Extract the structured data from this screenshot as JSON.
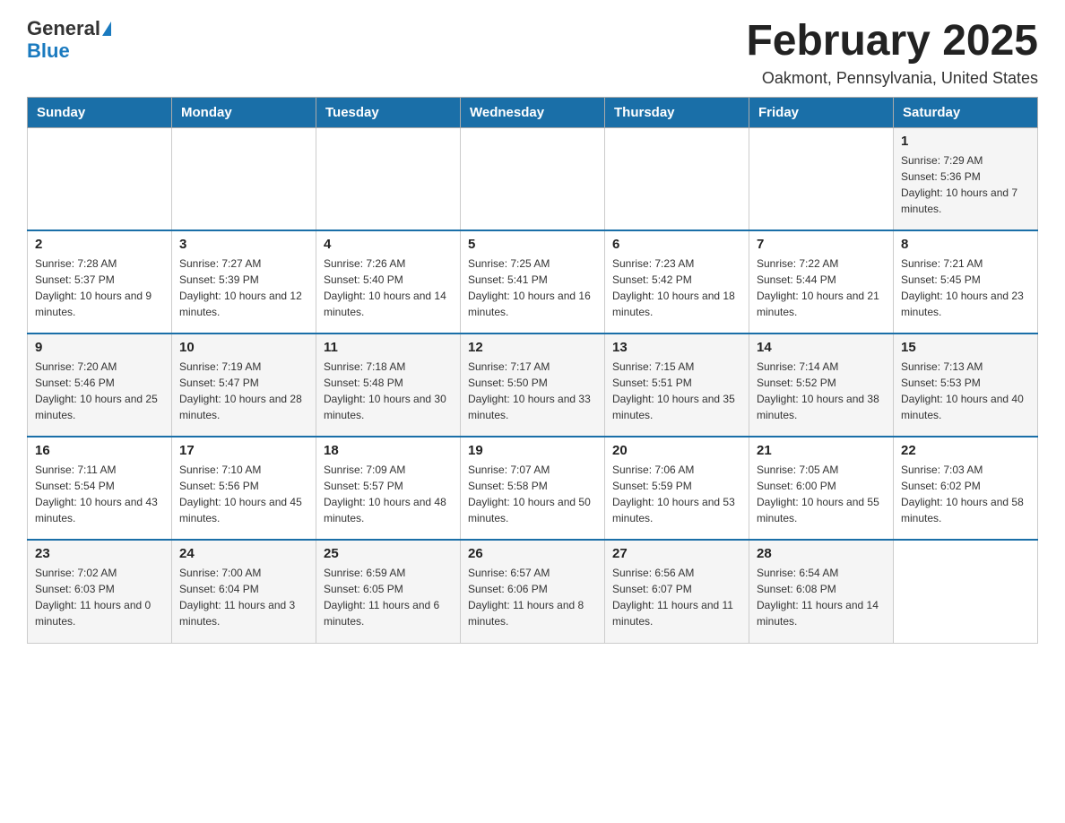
{
  "header": {
    "logo_general": "General",
    "logo_blue": "Blue",
    "month_title": "February 2025",
    "location": "Oakmont, Pennsylvania, United States"
  },
  "days_of_week": [
    "Sunday",
    "Monday",
    "Tuesday",
    "Wednesday",
    "Thursday",
    "Friday",
    "Saturday"
  ],
  "weeks": [
    [
      {
        "day": "",
        "info": ""
      },
      {
        "day": "",
        "info": ""
      },
      {
        "day": "",
        "info": ""
      },
      {
        "day": "",
        "info": ""
      },
      {
        "day": "",
        "info": ""
      },
      {
        "day": "",
        "info": ""
      },
      {
        "day": "1",
        "info": "Sunrise: 7:29 AM\nSunset: 5:36 PM\nDaylight: 10 hours and 7 minutes."
      }
    ],
    [
      {
        "day": "2",
        "info": "Sunrise: 7:28 AM\nSunset: 5:37 PM\nDaylight: 10 hours and 9 minutes."
      },
      {
        "day": "3",
        "info": "Sunrise: 7:27 AM\nSunset: 5:39 PM\nDaylight: 10 hours and 12 minutes."
      },
      {
        "day": "4",
        "info": "Sunrise: 7:26 AM\nSunset: 5:40 PM\nDaylight: 10 hours and 14 minutes."
      },
      {
        "day": "5",
        "info": "Sunrise: 7:25 AM\nSunset: 5:41 PM\nDaylight: 10 hours and 16 minutes."
      },
      {
        "day": "6",
        "info": "Sunrise: 7:23 AM\nSunset: 5:42 PM\nDaylight: 10 hours and 18 minutes."
      },
      {
        "day": "7",
        "info": "Sunrise: 7:22 AM\nSunset: 5:44 PM\nDaylight: 10 hours and 21 minutes."
      },
      {
        "day": "8",
        "info": "Sunrise: 7:21 AM\nSunset: 5:45 PM\nDaylight: 10 hours and 23 minutes."
      }
    ],
    [
      {
        "day": "9",
        "info": "Sunrise: 7:20 AM\nSunset: 5:46 PM\nDaylight: 10 hours and 25 minutes."
      },
      {
        "day": "10",
        "info": "Sunrise: 7:19 AM\nSunset: 5:47 PM\nDaylight: 10 hours and 28 minutes."
      },
      {
        "day": "11",
        "info": "Sunrise: 7:18 AM\nSunset: 5:48 PM\nDaylight: 10 hours and 30 minutes."
      },
      {
        "day": "12",
        "info": "Sunrise: 7:17 AM\nSunset: 5:50 PM\nDaylight: 10 hours and 33 minutes."
      },
      {
        "day": "13",
        "info": "Sunrise: 7:15 AM\nSunset: 5:51 PM\nDaylight: 10 hours and 35 minutes."
      },
      {
        "day": "14",
        "info": "Sunrise: 7:14 AM\nSunset: 5:52 PM\nDaylight: 10 hours and 38 minutes."
      },
      {
        "day": "15",
        "info": "Sunrise: 7:13 AM\nSunset: 5:53 PM\nDaylight: 10 hours and 40 minutes."
      }
    ],
    [
      {
        "day": "16",
        "info": "Sunrise: 7:11 AM\nSunset: 5:54 PM\nDaylight: 10 hours and 43 minutes."
      },
      {
        "day": "17",
        "info": "Sunrise: 7:10 AM\nSunset: 5:56 PM\nDaylight: 10 hours and 45 minutes."
      },
      {
        "day": "18",
        "info": "Sunrise: 7:09 AM\nSunset: 5:57 PM\nDaylight: 10 hours and 48 minutes."
      },
      {
        "day": "19",
        "info": "Sunrise: 7:07 AM\nSunset: 5:58 PM\nDaylight: 10 hours and 50 minutes."
      },
      {
        "day": "20",
        "info": "Sunrise: 7:06 AM\nSunset: 5:59 PM\nDaylight: 10 hours and 53 minutes."
      },
      {
        "day": "21",
        "info": "Sunrise: 7:05 AM\nSunset: 6:00 PM\nDaylight: 10 hours and 55 minutes."
      },
      {
        "day": "22",
        "info": "Sunrise: 7:03 AM\nSunset: 6:02 PM\nDaylight: 10 hours and 58 minutes."
      }
    ],
    [
      {
        "day": "23",
        "info": "Sunrise: 7:02 AM\nSunset: 6:03 PM\nDaylight: 11 hours and 0 minutes."
      },
      {
        "day": "24",
        "info": "Sunrise: 7:00 AM\nSunset: 6:04 PM\nDaylight: 11 hours and 3 minutes."
      },
      {
        "day": "25",
        "info": "Sunrise: 6:59 AM\nSunset: 6:05 PM\nDaylight: 11 hours and 6 minutes."
      },
      {
        "day": "26",
        "info": "Sunrise: 6:57 AM\nSunset: 6:06 PM\nDaylight: 11 hours and 8 minutes."
      },
      {
        "day": "27",
        "info": "Sunrise: 6:56 AM\nSunset: 6:07 PM\nDaylight: 11 hours and 11 minutes."
      },
      {
        "day": "28",
        "info": "Sunrise: 6:54 AM\nSunset: 6:08 PM\nDaylight: 11 hours and 14 minutes."
      },
      {
        "day": "",
        "info": ""
      }
    ]
  ]
}
